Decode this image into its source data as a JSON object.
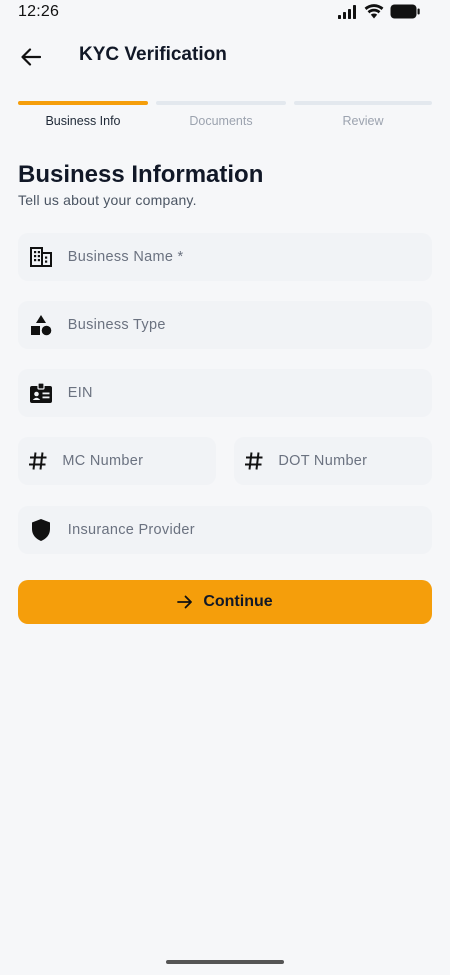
{
  "status_bar": {
    "time": "12:26",
    "icons": [
      "signal-icon",
      "wifi-icon",
      "battery-icon"
    ]
  },
  "app_bar": {
    "title": "KYC Verification",
    "back_icon": "arrow-back-icon"
  },
  "stepper": {
    "steps": [
      {
        "label": "Business Info",
        "active": true
      },
      {
        "label": "Documents",
        "active": false
      },
      {
        "label": "Review",
        "active": false
      }
    ]
  },
  "section": {
    "title": "Business Information",
    "subtitle": "Tell us about your company."
  },
  "form": {
    "business_name": {
      "placeholder": "Business Name *",
      "icon": "building-icon"
    },
    "business_type": {
      "placeholder": "Business Type",
      "icon": "shapes-icon"
    },
    "ein": {
      "placeholder": "EIN",
      "icon": "badge-icon"
    },
    "mc_number": {
      "placeholder": "MC Number",
      "icon": "hash-icon"
    },
    "dot_number": {
      "placeholder": "DOT Number",
      "icon": "hash-icon"
    },
    "insurance_provider": {
      "placeholder": "Insurance Provider",
      "icon": "shield-icon"
    }
  },
  "continue_button": {
    "label": "Continue",
    "icon": "arrow-forward-icon"
  },
  "colors": {
    "accent": "#f59e0b",
    "background": "#f6f7f9",
    "field_bg": "#f1f3f6",
    "text": "#111827"
  }
}
